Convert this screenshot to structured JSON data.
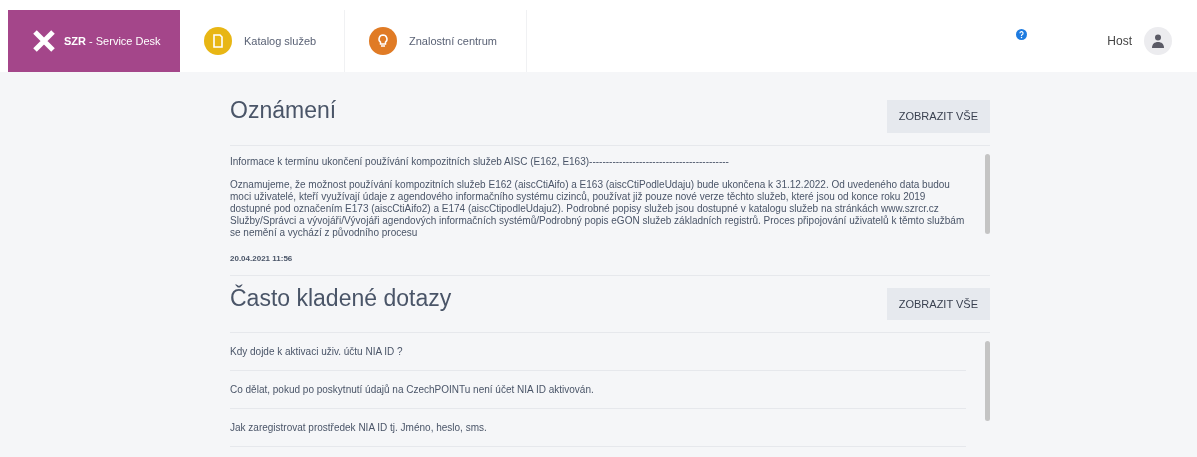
{
  "header": {
    "brand": "**SZR** - Service Desk",
    "nav": [
      {
        "kind": "catalog",
        "label": "Katalog služeb"
      },
      {
        "kind": "knowledge",
        "label": "Znalostní centrum"
      }
    ],
    "user": "Host"
  },
  "announcements": {
    "title": "Oznámení",
    "button": "ZOBRAZIT VŠE",
    "items": [
      {
        "title": "Informace k termínu ukončení používání kompozitních služeb AISC (E162, E163)------------------------------------------",
        "body": "Oznamujeme, že možnost používání kompozitních služeb E162 (aiscCtiAifo) a E163 (aiscCtiPodleUdaju) bude ukončena k 31.12.2022. Od uvedeného data budou moci uživatelé, kteří využívají údaje z agendového informačního systému cizinců, používat již pouze nové verze těchto služeb, které jsou od konce roku 2019 dostupné pod označením E173 (aiscCtiAifo2) a E174 (aiscCtipodleUdaju2). Podrobné popisy služeb jsou dostupné v katalogu služeb na stránkách www.szrcr.cz Služby/Správci a vývojáři/Vývojáři agendových informačních systémů/Podrobný popis eGON služeb základních registrů. Proces připojování uživatelů k těmto službám se nemění a vychází z původního procesu",
        "date": "20.04.2021 11:56"
      }
    ]
  },
  "faq": {
    "title": "Často kladené dotazy",
    "button": "ZOBRAZIT VŠE",
    "items": [
      "Kdy dojde k aktivaci uživ. účtu NIA ID ?",
      "Co dělat, pokud po poskytnutí údajů na CzechPOINTu není účet NIA ID aktivován.",
      "Jak zaregistrovat prostředek NIA ID tj. Jméno, heslo, sms."
    ]
  }
}
